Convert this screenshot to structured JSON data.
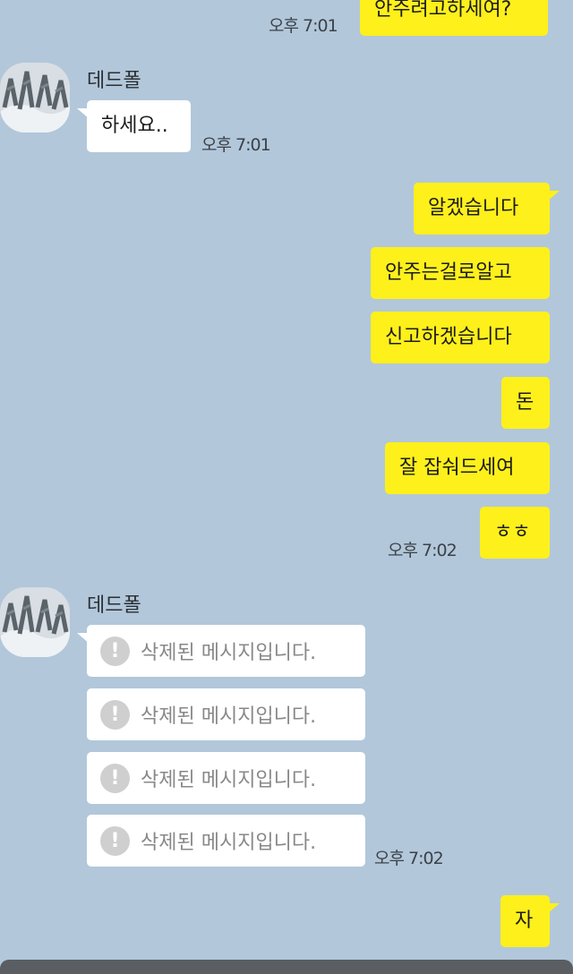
{
  "messages": {
    "top_bubble": "안주려고하세여?",
    "top_time": "오후 7:01",
    "first_sender": "데드폴",
    "first_bubble": "하세요..",
    "first_time": "오후 7:01",
    "my_block": [
      "알겠습니다",
      "안주는걸로알고",
      "신고하겠습니다",
      "돈",
      "잘 잡숴드세여",
      "ㅎㅎ"
    ],
    "my_block_time": "오후 7:02",
    "second_sender": "데드폴",
    "deleted_text": "삭제된 메시지입니다.",
    "deleted_time": "오후 7:02",
    "last_bubble": "자"
  },
  "icons": {
    "avatar": "profile-photo-icon",
    "warning": "exclamation-icon"
  },
  "colors": {
    "background": "#b2c7da",
    "my_bubble": "#fef01b",
    "their_bubble": "#ffffff"
  }
}
